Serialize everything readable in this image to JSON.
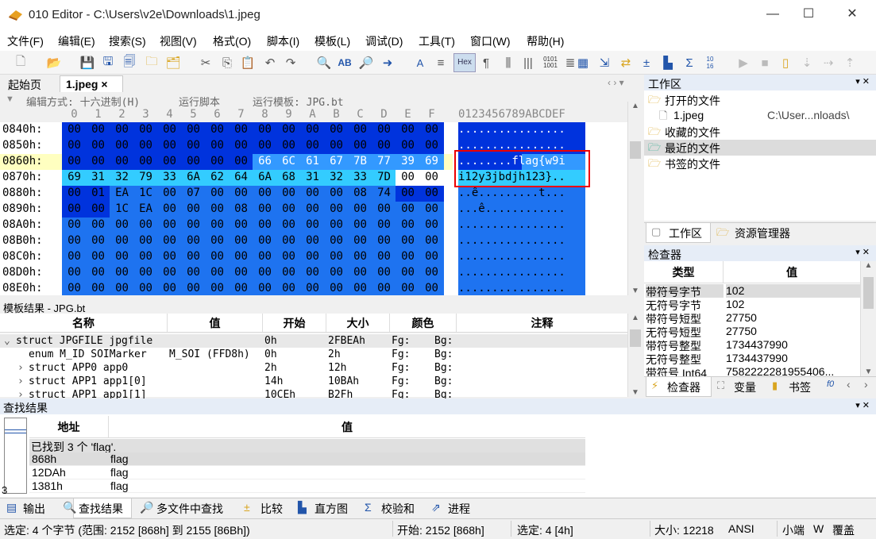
{
  "title": "010 Editor - C:\\Users\\v2e\\Downloads\\1.jpeg",
  "menu": [
    "文件(F)",
    "编辑(E)",
    "搜索(S)",
    "视图(V)",
    "格式(O)",
    "脚本(I)",
    "模板(L)",
    "调试(D)",
    "工具(T)",
    "窗口(W)",
    "帮助(H)"
  ],
  "tabs": {
    "home": "起始页",
    "file": "1.jpeg ×"
  },
  "editbar": {
    "edit_mode": "编辑方式: 十六进制(H)",
    "run_script": "运行脚本",
    "run_template": "运行模板: JPG.bt"
  },
  "hex_header": {
    "cols": [
      "0",
      "1",
      "2",
      "3",
      "4",
      "5",
      "6",
      "7",
      "8",
      "9",
      "A",
      "B",
      "C",
      "D",
      "E",
      "F"
    ],
    "ascii": "0123456789ABCDEF"
  },
  "hex_rows": [
    {
      "addr": "0840h:",
      "bytes": [
        "00",
        "00",
        "00",
        "00",
        "00",
        "00",
        "00",
        "00",
        "00",
        "00",
        "00",
        "00",
        "00",
        "00",
        "00",
        "00"
      ],
      "ascii": "................"
    },
    {
      "addr": "0850h:",
      "bytes": [
        "00",
        "00",
        "00",
        "00",
        "00",
        "00",
        "00",
        "00",
        "00",
        "00",
        "00",
        "00",
        "00",
        "00",
        "00",
        "00"
      ],
      "ascii": "................"
    },
    {
      "addr": "0860h:",
      "bytes": [
        "00",
        "00",
        "00",
        "00",
        "00",
        "00",
        "00",
        "00",
        "66",
        "6C",
        "61",
        "67",
        "7B",
        "77",
        "39",
        "69"
      ],
      "ascii": "........flag{w9i"
    },
    {
      "addr": "0870h:",
      "bytes": [
        "69",
        "31",
        "32",
        "79",
        "33",
        "6A",
        "62",
        "64",
        "6A",
        "68",
        "31",
        "32",
        "33",
        "7D",
        "00",
        "00"
      ],
      "ascii": "i12y3jbdjh123}.."
    },
    {
      "addr": "0880h:",
      "bytes": [
        "00",
        "01",
        "EA",
        "1C",
        "00",
        "07",
        "00",
        "00",
        "00",
        "00",
        "00",
        "00",
        "08",
        "74",
        "00",
        "00"
      ],
      "ascii": "..ê.........t..."
    },
    {
      "addr": "0890h:",
      "bytes": [
        "00",
        "00",
        "1C",
        "EA",
        "00",
        "00",
        "00",
        "08",
        "00",
        "00",
        "00",
        "00",
        "00",
        "00",
        "00",
        "00"
      ],
      "ascii": "...ê............"
    },
    {
      "addr": "08A0h:",
      "bytes": [
        "00",
        "00",
        "00",
        "00",
        "00",
        "00",
        "00",
        "00",
        "00",
        "00",
        "00",
        "00",
        "00",
        "00",
        "00",
        "00"
      ],
      "ascii": "................"
    },
    {
      "addr": "08B0h:",
      "bytes": [
        "00",
        "00",
        "00",
        "00",
        "00",
        "00",
        "00",
        "00",
        "00",
        "00",
        "00",
        "00",
        "00",
        "00",
        "00",
        "00"
      ],
      "ascii": "................"
    },
    {
      "addr": "08C0h:",
      "bytes": [
        "00",
        "00",
        "00",
        "00",
        "00",
        "00",
        "00",
        "00",
        "00",
        "00",
        "00",
        "00",
        "00",
        "00",
        "00",
        "00"
      ],
      "ascii": "................"
    },
    {
      "addr": "08D0h:",
      "bytes": [
        "00",
        "00",
        "00",
        "00",
        "00",
        "00",
        "00",
        "00",
        "00",
        "00",
        "00",
        "00",
        "00",
        "00",
        "00",
        "00"
      ],
      "ascii": "................"
    },
    {
      "addr": "08E0h:",
      "bytes": [
        "00",
        "00",
        "00",
        "00",
        "00",
        "00",
        "00",
        "00",
        "00",
        "00",
        "00",
        "00",
        "00",
        "00",
        "00",
        "00"
      ],
      "ascii": "................"
    }
  ],
  "colors": {
    "dark_blue": "#0033dd",
    "mid_blue": "#1e73f0",
    "light_blue": "#33ccff",
    "selection": "#3399ff",
    "highlight_yellow": "#ffffc0"
  },
  "workspace": {
    "title": "工作区",
    "items": [
      "打开的文件",
      "1.jpeg",
      "C:\\User...nloads\\",
      "收藏的文件",
      "最近的文件",
      "书签的文件"
    ],
    "tabs": [
      "工作区",
      "资源管理器"
    ]
  },
  "inspector": {
    "title": "检查器",
    "headers": [
      "类型",
      "值"
    ],
    "rows": [
      {
        "type": "带符号字节",
        "value": "102"
      },
      {
        "type": "无符号字节",
        "value": "102"
      },
      {
        "type": "带符号短型",
        "value": "27750"
      },
      {
        "type": "无符号短型",
        "value": "27750"
      },
      {
        "type": "带符号整型",
        "value": "1734437990"
      },
      {
        "type": "无符号整型",
        "value": "1734437990"
      },
      {
        "type": "带符号 Int64",
        "value": "7582222281955406..."
      }
    ],
    "tabs": [
      "检查器",
      "变量",
      "书签"
    ]
  },
  "template": {
    "title": "模板结果 - JPG.bt",
    "headers": [
      "名称",
      "值",
      "开始",
      "大小",
      "颜色",
      "注释"
    ],
    "rows": [
      {
        "name": "struct JPGFILE jpgfile",
        "value": "",
        "start": "0h",
        "size": "2FBEAh",
        "fg": "Fg:",
        "bg": "Bg:"
      },
      {
        "name": "enum M_ID SOIMarker",
        "value": "M_SOI (FFD8h)",
        "start": "0h",
        "size": "2h",
        "fg": "Fg:",
        "bg": "Bg:"
      },
      {
        "name": "struct APP0 app0",
        "value": "",
        "start": "2h",
        "size": "12h",
        "fg": "Fg:",
        "bg": "Bg:"
      },
      {
        "name": "struct APP1 app1[0]",
        "value": "",
        "start": "14h",
        "size": "10BAh",
        "fg": "Fg:",
        "bg": "Bg:"
      },
      {
        "name": "struct APP1 app1[1]",
        "value": "",
        "start": "10CEh",
        "size": "B2Fh",
        "fg": "Fg:",
        "bg": "Bg:"
      }
    ]
  },
  "find": {
    "title": "查找结果",
    "headers": [
      "地址",
      "值"
    ],
    "summary": "已找到 3 个 'flag'.",
    "rows": [
      {
        "addr": "868h",
        "value": "flag"
      },
      {
        "addr": "12DAh",
        "value": "flag"
      },
      {
        "addr": "1381h",
        "value": "flag"
      }
    ],
    "count": "3"
  },
  "bottom_tabs": [
    "输出",
    "查找结果",
    "多文件中查找",
    "比较",
    "直方图",
    "校验和",
    "进程"
  ],
  "status": {
    "selection": "选定: 4 个字节 (范围: 2152 [868h] 到 2155 [86Bh])",
    "start": "开始: 2152 [868h]",
    "sel": "选定: 4 [4h]",
    "size": "大小: 12218",
    "encoding": "ANSI",
    "endian": "小端",
    "w": "W",
    "mode": "覆盖"
  }
}
